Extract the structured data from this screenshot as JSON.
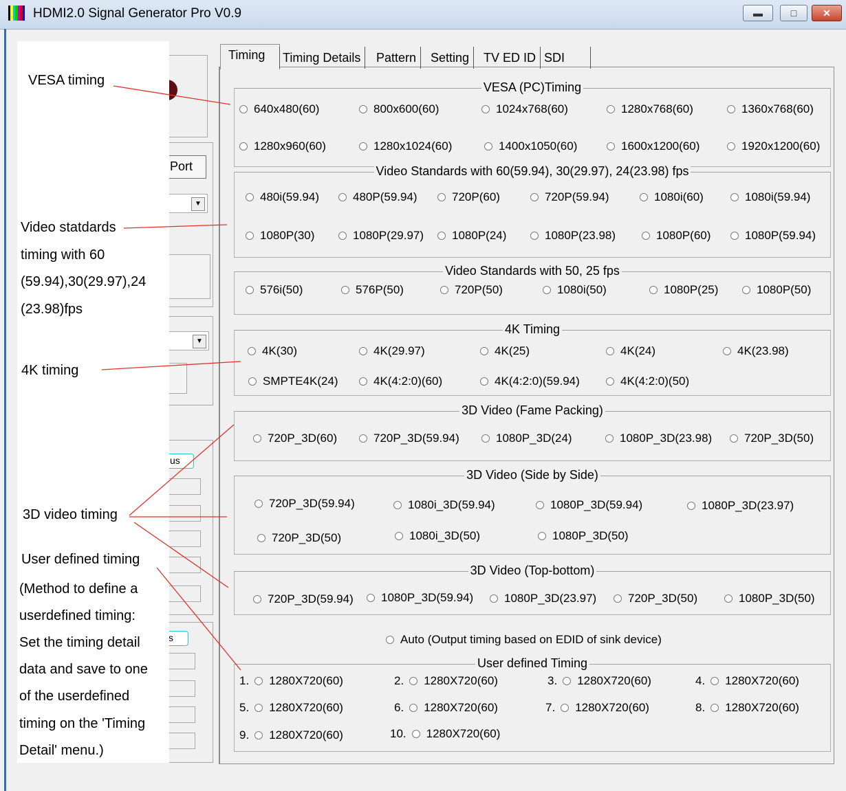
{
  "window": {
    "title": "HDMI2.0 Signal Generator Pro V0.9",
    "minimize_glyph": "▬",
    "maximize_glyph": "□",
    "close_glyph": "✕"
  },
  "background_panel": {
    "port_button_label": "Port",
    "status_tag_1": "us",
    "status_tag_2": "s"
  },
  "annotations": {
    "vesa": "VESA timing",
    "video_std_lines": [
      "Video statdards",
      "timing with 60",
      "(59.94),30(29.97),24",
      "(23.98)fps"
    ],
    "fourk": "4K timing",
    "threed": "3D video timing",
    "user_lines": [
      "User defined timing",
      "(Method to define a",
      "userdefined timing:",
      "Set the timing detail",
      "data and save to one",
      "of the userdefined",
      "timing on the 'Timing",
      "Detail' menu.)"
    ]
  },
  "tabs": [
    "Timing",
    "Timing Details",
    "Pattern",
    "Setting",
    "TV ED ID",
    "SDI"
  ],
  "groups": {
    "vesa": {
      "title": "VESA  (PC)Timing",
      "options": [
        "640x480(60)",
        "800x600(60)",
        "1024x768(60)",
        "1280x768(60)",
        "1360x768(60)",
        "1280x960(60)",
        "1280x1024(60)",
        "1400x1050(60)",
        "1600x1200(60)",
        "1920x1200(60)"
      ]
    },
    "video60": {
      "title": "Video Standards with 60(59.94), 30(29.97), 24(23.98) fps",
      "options": [
        "480i(59.94)",
        "480P(59.94)",
        "720P(60)",
        "720P(59.94)",
        "1080i(60)",
        "1080i(59.94)",
        "1080P(30)",
        "1080P(29.97)",
        "1080P(24)",
        "1080P(23.98)",
        "1080P(60)",
        "1080P(59.94)"
      ]
    },
    "video50": {
      "title": "Video Standards with 50, 25 fps",
      "options": [
        "576i(50)",
        "576P(50)",
        "720P(50)",
        "1080i(50)",
        "1080P(25)",
        "1080P(50)"
      ]
    },
    "fourk": {
      "title": "4K Timing",
      "options": [
        "4K(30)",
        "4K(29.97)",
        "4K(25)",
        "4K(24)",
        "4K(23.98)",
        "SMPTE4K(24)",
        "4K(4:2:0)(60)",
        "4K(4:2:0)(59.94)",
        "4K(4:2:0)(50)"
      ]
    },
    "fp": {
      "title": "3D Video (Fame Packing)",
      "options": [
        "720P_3D(60)",
        "720P_3D(59.94)",
        "1080P_3D(24)",
        "1080P_3D(23.98)",
        "720P_3D(50)"
      ]
    },
    "sbs": {
      "title": "3D Video (Side by Side)",
      "options": [
        "720P_3D(59.94)",
        "1080i_3D(59.94)",
        "1080P_3D(59.94)",
        "1080P_3D(23.97)",
        "720P_3D(50)",
        "1080i_3D(50)",
        "1080P_3D(50)"
      ]
    },
    "tb": {
      "title": "3D Video (Top-bottom)",
      "options": [
        "720P_3D(59.94)",
        "1080P_3D(59.94)",
        "1080P_3D(23.97)",
        "720P_3D(50)",
        "1080P_3D(50)"
      ]
    }
  },
  "auto_option": "Auto (Output timing based on EDID of sink device)",
  "user_defined": {
    "title": "User defined Timing",
    "items": [
      {
        "num": "1.",
        "label": "1280X720(60)"
      },
      {
        "num": "2.",
        "label": "1280X720(60)"
      },
      {
        "num": "3.",
        "label": "1280X720(60)"
      },
      {
        "num": "4.",
        "label": "1280X720(60)"
      },
      {
        "num": "5.",
        "label": "1280X720(60)"
      },
      {
        "num": "6.",
        "label": "1280X720(60)"
      },
      {
        "num": "7.",
        "label": "1280X720(60)"
      },
      {
        "num": "8.",
        "label": "1280X720(60)"
      },
      {
        "num": "9.",
        "label": "1280X720(60)"
      },
      {
        "num": "10.",
        "label": "1280X720(60)"
      }
    ]
  },
  "colors": {
    "annotation_line": "#e0302a",
    "titlebar_top": "#dfe9f5",
    "titlebar_bottom": "#c9d9ec",
    "window_bg": "#f0f0f0"
  }
}
